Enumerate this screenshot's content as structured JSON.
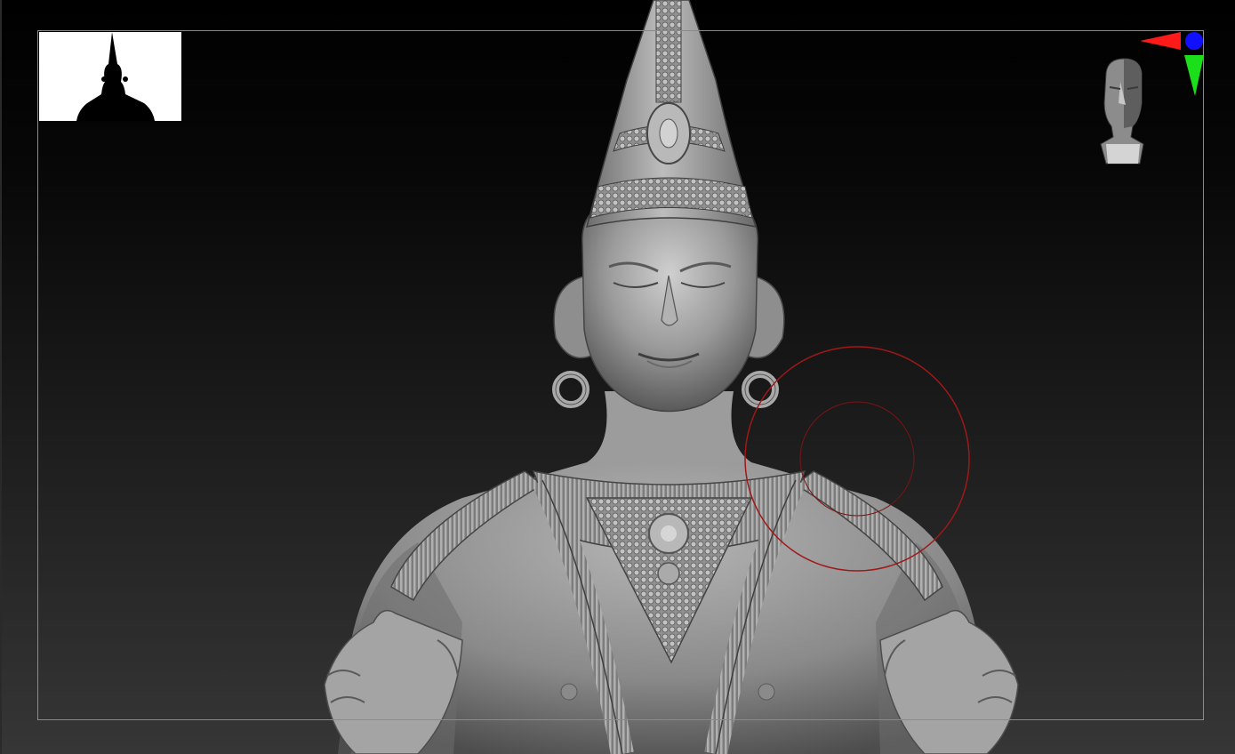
{
  "viewport": {
    "background_top": "#000000",
    "background_bottom": "#363636",
    "frame_color": "#8a8a8a"
  },
  "thumbnail": {
    "background": "#ffffff",
    "silhouette_color": "#000000"
  },
  "model": {
    "subject": "sculpted-deity-figure",
    "material_color": "#9a9a9a"
  },
  "brush_cursor": {
    "color": "#a01818"
  },
  "navigation": {
    "head_icon": "head-orientation-icon",
    "axis_colors": {
      "x": "#ff1a1a",
      "y": "#1adf1a",
      "z": "#1010ff"
    }
  }
}
